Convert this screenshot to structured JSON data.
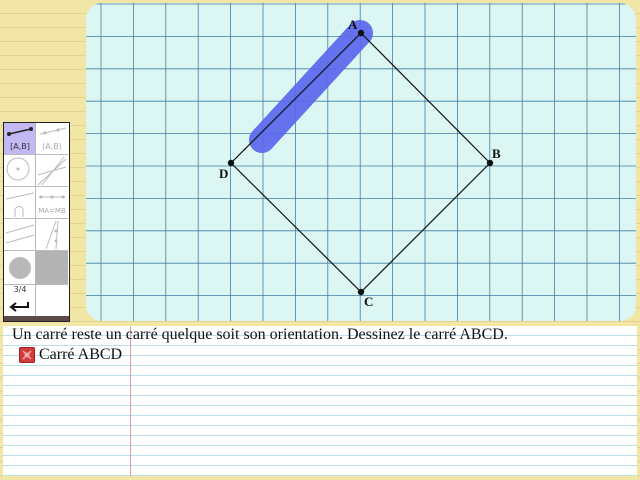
{
  "toolbar": {
    "segment_label": "[A,B]",
    "ray_label": "(A,B)",
    "midpoint_label": "MA=MB",
    "page_indicator": "3/4",
    "undo_icon": "undo-arrow-icon"
  },
  "figure": {
    "points": [
      {
        "name": "A"
      },
      {
        "name": "B"
      },
      {
        "name": "C"
      },
      {
        "name": "D"
      }
    ],
    "stroke_color": "#5a66ee",
    "line_color": "#111111",
    "grid_color": "#3f7fa3"
  },
  "notebook": {
    "instruction": "Un carré reste un carré quelque soit son orientation. Dessinez le carré ABCD.",
    "task_label": "Carré ABCD",
    "task_icon": "red-status-icon"
  }
}
